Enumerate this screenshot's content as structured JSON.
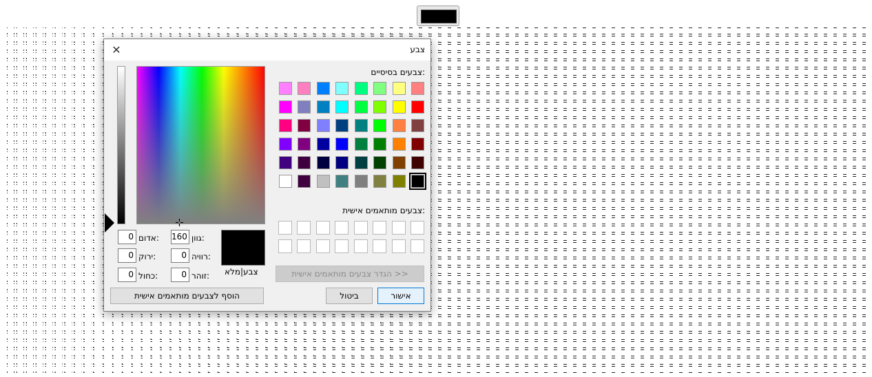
{
  "dialog": {
    "title": "צבע",
    "basic_colors_label": "צבעים בסיסיים:",
    "custom_colors_label": "צבעים מותאמים אישית:",
    "define_custom_button": "הגדר צבעים מותאמים אישית >>",
    "ok_button": "אישור",
    "cancel_button": "ביטול",
    "add_custom_button": "הוסף לצבעים מותאמים אישית",
    "preview_label": "צבע|מלא",
    "fields": {
      "hue_label": "גוון:",
      "hue_value": "160",
      "sat_label": "רוויה:",
      "sat_value": "0",
      "lum_label": "זוהר:",
      "lum_value": "0",
      "red_label": "אדום:",
      "red_value": "0",
      "green_label": "ירוק:",
      "green_value": "0",
      "blue_label": "כחול:",
      "blue_value": "0"
    }
  },
  "basic_colors": [
    [
      "#ff8080",
      "#ffff80",
      "#80ff80",
      "#00ff80",
      "#80ffff",
      "#0080ff",
      "#ff80c0",
      "#ff80ff"
    ],
    [
      "#ff0000",
      "#ffff00",
      "#80ff00",
      "#00ff40",
      "#00ffff",
      "#0080c0",
      "#8080c0",
      "#ff00ff"
    ],
    [
      "#804040",
      "#ff8040",
      "#00ff00",
      "#008080",
      "#004080",
      "#8080ff",
      "#800040",
      "#ff0080"
    ],
    [
      "#800000",
      "#ff8000",
      "#008000",
      "#008040",
      "#0000ff",
      "#0000a0",
      "#800080",
      "#8000ff"
    ],
    [
      "#400000",
      "#804000",
      "#004000",
      "#004040",
      "#000080",
      "#000040",
      "#400040",
      "#400080"
    ],
    [
      "#000000",
      "#808000",
      "#808040",
      "#808080",
      "#408080",
      "#c0c0c0",
      "#400040",
      "#ffffff"
    ]
  ],
  "selected_swatch": "#000000",
  "current_color": "#000000"
}
